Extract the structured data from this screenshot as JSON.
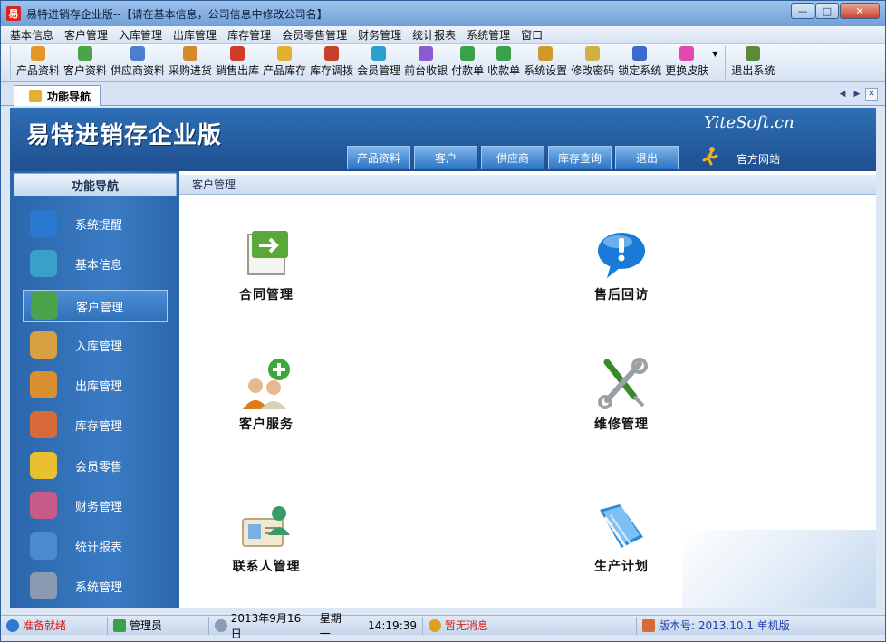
{
  "window": {
    "title": "易特进销存企业版--【请在基本信息，公司信息中修改公司名】",
    "app_icon_glyph": "易",
    "buttons": {
      "minimize": "—",
      "maximize": "□",
      "close": "✕"
    }
  },
  "menubar": {
    "items": [
      "基本信息",
      "客户管理",
      "入库管理",
      "出库管理",
      "库存管理",
      "会员零售管理",
      "财务管理",
      "统计报表",
      "系统管理",
      "窗口"
    ]
  },
  "toolbar": {
    "items": [
      {
        "label": "产品资料",
        "icon": "product-icon",
        "color": "#e8962a"
      },
      {
        "label": "客户资料",
        "icon": "customer-icon",
        "color": "#4aa24a"
      },
      {
        "label": "供应商资料",
        "icon": "supplier-icon",
        "color": "#4a7fd0"
      },
      {
        "label": "采购进货",
        "icon": "truck-icon",
        "color": "#d28a2a"
      },
      {
        "label": "销售出库",
        "icon": "cart-icon",
        "color": "#d23a2a"
      },
      {
        "label": "产品库存",
        "icon": "box-icon",
        "color": "#e0b030"
      },
      {
        "label": "库存调拨",
        "icon": "transfer-icon",
        "color": "#c8402a"
      },
      {
        "label": "会员管理",
        "icon": "member-icon",
        "color": "#2aa0d0"
      },
      {
        "label": "前台收银",
        "icon": "cashier-icon",
        "color": "#8a5ad0"
      },
      {
        "label": "付款单",
        "icon": "payment-icon",
        "color": "#3aa04a"
      },
      {
        "label": "收款单",
        "icon": "receipt-icon",
        "color": "#3aa04a"
      },
      {
        "label": "系统设置",
        "icon": "settings-icon",
        "color": "#d09a2a"
      },
      {
        "label": "修改密码",
        "icon": "password-icon",
        "color": "#d0b040"
      },
      {
        "label": "锁定系统",
        "icon": "lock-icon",
        "color": "#3a6ad0"
      },
      {
        "label": "更换皮肤",
        "icon": "skin-icon",
        "color": "#e04ab0"
      },
      {
        "label": "退出系统",
        "icon": "exit-icon",
        "color": "#5a8a3a"
      }
    ]
  },
  "document_tab": {
    "label": "功能导航"
  },
  "banner": {
    "title": "易特进销存企业版",
    "brand": "YiteSoft.cn",
    "tabs": [
      "产品资料",
      "客户",
      "供应商",
      "库存查询",
      "退出"
    ],
    "site_link": "官方网站"
  },
  "sidebar": {
    "header": "功能导航",
    "items": [
      {
        "label": "系统提醒",
        "icon": "info-icon",
        "color": "#2b78d0",
        "active": false
      },
      {
        "label": "基本信息",
        "icon": "cubes-icon",
        "color": "#3aa0c8",
        "active": false
      },
      {
        "label": "客户管理",
        "icon": "customers-icon",
        "color": "#4aa24a",
        "active": true
      },
      {
        "label": "入库管理",
        "icon": "inbound-box-icon",
        "color": "#d8a040",
        "active": false
      },
      {
        "label": "出库管理",
        "icon": "outbound-box-icon",
        "color": "#d89030",
        "active": false
      },
      {
        "label": "库存管理",
        "icon": "warehouse-icon",
        "color": "#d86a3a",
        "active": false
      },
      {
        "label": "会员零售",
        "icon": "member-retail-icon",
        "color": "#e8c030",
        "active": false
      },
      {
        "label": "财务管理",
        "icon": "finance-icon",
        "color": "#c85a8a",
        "active": false
      },
      {
        "label": "统计报表",
        "icon": "chart-icon",
        "color": "#4a8ad0",
        "active": false
      },
      {
        "label": "系统管理",
        "icon": "gears-icon",
        "color": "#8a9ab0",
        "active": false
      }
    ]
  },
  "main": {
    "tab_label": "客户管理",
    "features": [
      {
        "label": "合同管理",
        "icon": "contract-icon",
        "color": "#5aa83a"
      },
      {
        "label": "售后回访",
        "icon": "speech-bubble-icon",
        "color": "#1a7ad8"
      },
      {
        "label": "客户服务",
        "icon": "customer-service-icon",
        "color": "#3aa83a"
      },
      {
        "label": "维修管理",
        "icon": "tools-icon",
        "color": "#5a9a3a"
      },
      {
        "label": "联系人管理",
        "icon": "contacts-icon",
        "color": "#3a9a6a"
      },
      {
        "label": "生产计划",
        "icon": "folder-icon",
        "color": "#2a8ad8"
      }
    ]
  },
  "statusbar": {
    "ready": "准备就绪",
    "user": "管理员",
    "date": "2013年9月16日",
    "weekday": "星期一",
    "time": "14:19:39",
    "message": "暂无消息",
    "version": "版本号: 2013.10.1 单机版"
  }
}
